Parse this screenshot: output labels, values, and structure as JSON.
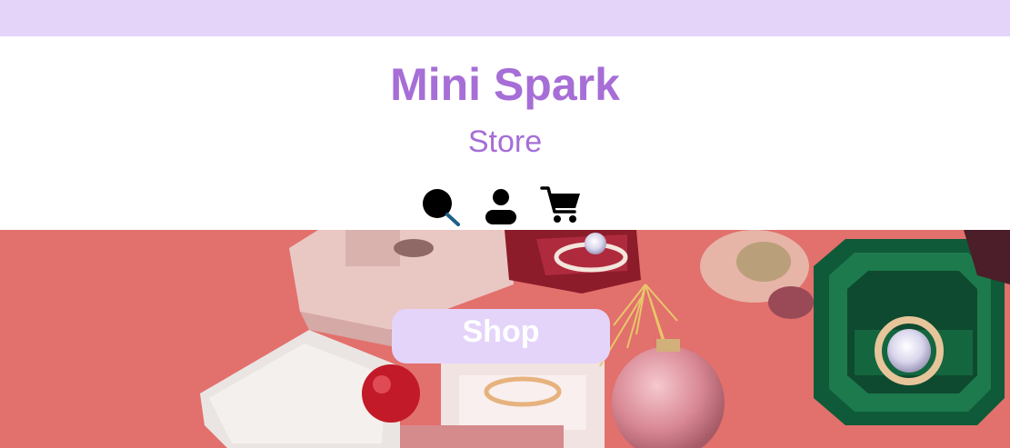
{
  "brand": {
    "title": "Mini Spark",
    "subtitle": "Store"
  },
  "header_icons": [
    {
      "name": "search-icon"
    },
    {
      "name": "user-icon"
    },
    {
      "name": "cart-icon"
    }
  ],
  "hero": {
    "cta_label": "Shop",
    "image_subject": "jewelry-ring-boxes"
  },
  "colors": {
    "top_bar": "#e4d4fa",
    "brand": "#a66ed6",
    "button_bg": "#e4d4fa",
    "button_text": "#ffffff",
    "hero_bg": "#e2706c"
  }
}
